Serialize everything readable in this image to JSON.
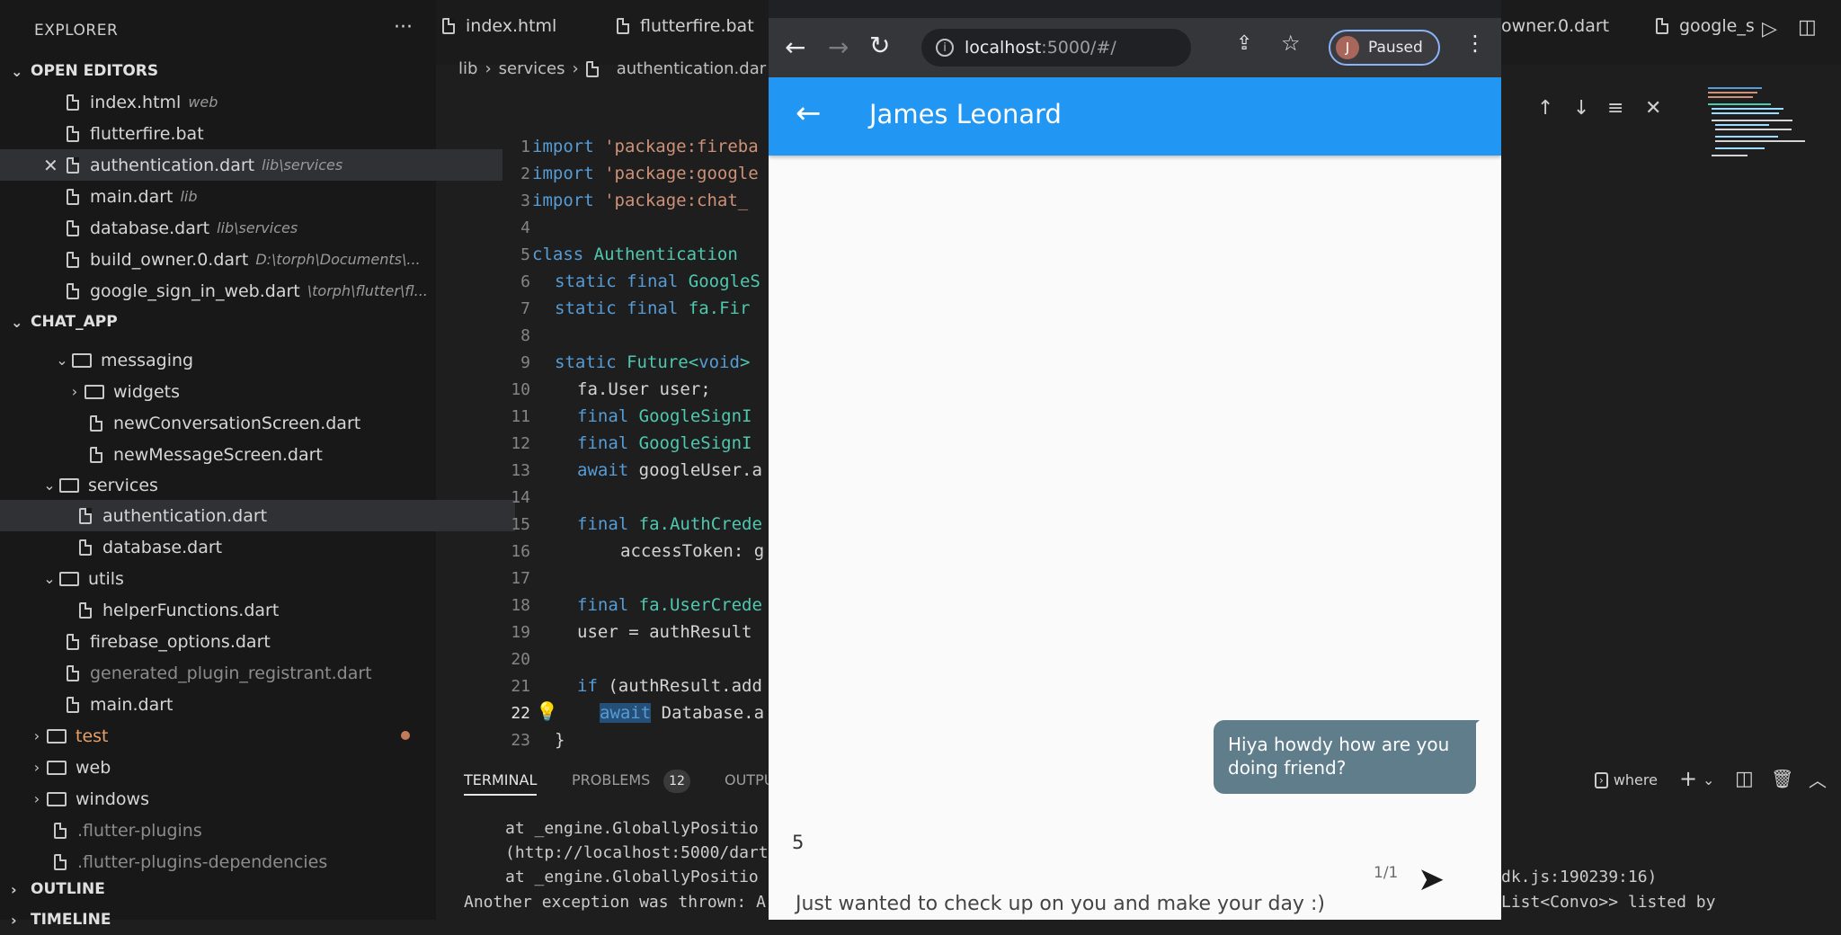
{
  "sidebar": {
    "title": "EXPLORER",
    "more": "···",
    "open_editors_title": "OPEN EDITORS",
    "open_editors": [
      {
        "name": "index.html",
        "desc": "web"
      },
      {
        "name": "flutterfire.bat",
        "desc": ""
      },
      {
        "name": "authentication.dart",
        "desc": "lib\\services"
      },
      {
        "name": "main.dart",
        "desc": "lib"
      },
      {
        "name": "database.dart",
        "desc": "lib\\services"
      },
      {
        "name": "build_owner.0.dart",
        "desc": "D:\\torph\\Documents\\..."
      },
      {
        "name": "google_sign_in_web.dart",
        "desc": "\\torph\\flutter\\fl..."
      }
    ],
    "project_title": "CHAT_APP",
    "tree": [
      "messaging",
      "widgets",
      "newConversationScreen.dart",
      "newMessageScreen.dart",
      "services",
      "authentication.dart",
      "database.dart",
      "utils",
      "helperFunctions.dart",
      "firebase_options.dart",
      "generated_plugin_registrant.dart",
      "main.dart",
      "test",
      "web",
      "windows",
      ".flutter-plugins",
      ".flutter-plugins-dependencies"
    ],
    "outline_title": "OUTLINE",
    "timeline_title": "TIMELINE"
  },
  "editor": {
    "tabs": [
      "index.html",
      "flutterfire.bat",
      "owner.0.dart",
      "google_s"
    ],
    "breadcrumb": [
      "lib",
      "services",
      "authentication.dar"
    ],
    "line_numbers": [
      "1",
      "2",
      "3",
      "4",
      "5",
      "6",
      "7",
      "8",
      "9",
      "10",
      "11",
      "12",
      "13",
      "14",
      "15",
      "16",
      "17",
      "18",
      "19",
      "20",
      "21",
      "22",
      "23"
    ],
    "code": {
      "l1": "'package:fireba",
      "l2": "'package:google",
      "l3": "'package:chat_",
      "l5": "Authentication",
      "l6": "GoogleS",
      "l7": "fa.Fir",
      "l9a": "Future<",
      "l9b": "void",
      "l9c": ">",
      "l10": "fa.User user;",
      "l11": "GoogleSignI",
      "l12": "GoogleSignI",
      "l13": "googleUser.a",
      "l15": "fa.AuthCrede",
      "l16": "accessToken: g",
      "l18": "fa.UserCrede",
      "l19": "user = authResult",
      "l21": "(authResult.add",
      "l22": "Database.a",
      "l23": "}",
      "kw_import": "import",
      "kw_class": "class",
      "kw_static": "static",
      "kw_final": "final",
      "kw_await": "await",
      "kw_if": "if"
    }
  },
  "panel": {
    "tabs": [
      "TERMINAL",
      "PROBLEMS",
      "OUTPU"
    ],
    "problems_count": "12",
    "right_label": "where",
    "lines": [
      "at _engine.GloballyPositio",
      "(http://localhost:5000/dart",
      "at _engine.GloballyPositio",
      "Another exception was thrown: A"
    ],
    "right_lines": [
      "dk.js:190239:16)",
      "List<Convo>> listed by"
    ]
  },
  "browser": {
    "url_host": "localhost",
    "url_path": ":5000/#/",
    "profile_initial": "J",
    "profile_label": "Paused",
    "chat_title": "James Leonard",
    "bubble_text": "Hiya howdy how are you doing friend?",
    "count_label": "5",
    "counter": "1/1",
    "input_value": "Just wanted to check up on you and make your day :)"
  },
  "colors": {
    "appbar": "#2196f3",
    "bubble": "#607d8b",
    "editor_bg": "#1e1e1e",
    "sidebar_bg": "#181818"
  }
}
